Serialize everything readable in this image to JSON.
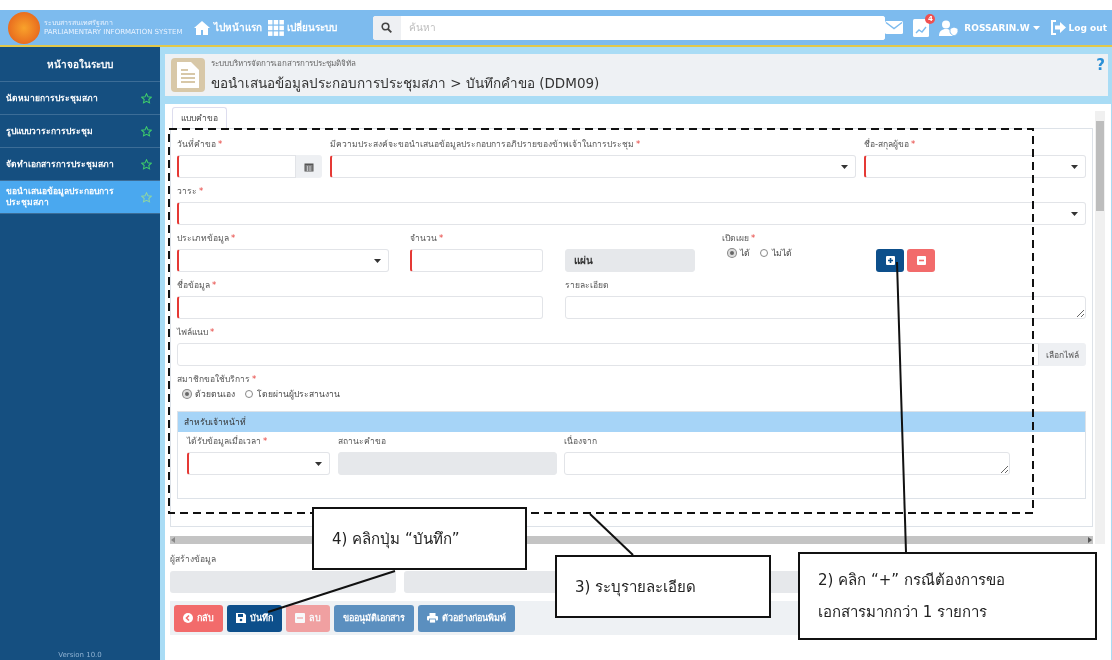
{
  "header": {
    "logo_title": "ระบบสารสนเทศรัฐสภา",
    "logo_subtitle": "PARLIAMENTARY INFORMATION SYSTEM",
    "nav": [
      {
        "label": "ไปหน้าแรก",
        "kind": "home"
      },
      {
        "label": "เปลี่ยนระบบ",
        "kind": "apps"
      }
    ],
    "search": {
      "placeholder": "ค้นหา"
    },
    "notification_badge": "4",
    "user": "ROSSARIN.W",
    "logout": "Log out"
  },
  "sidebar": {
    "title": "หน้าจอในระบบ",
    "items": [
      {
        "label": "นัดหมายการประชุมสภา",
        "selected": false
      },
      {
        "label": "รูปแบบวาระการประชุม",
        "selected": false
      },
      {
        "label": "จัดทำเอกสารการประชุมสภา",
        "selected": false
      },
      {
        "label": "ขอนำเสนอข้อมูลประกอบการประชุมสภา",
        "selected": true
      }
    ],
    "version": "Version 10.0"
  },
  "page": {
    "subtitle": "ระบบบริหารจัดการเอกสารการประชุมดิจิทัล",
    "title": "ขอนำเสนอข้อมูลประกอบการประชุมสภา > บันทึกคำขอ (DDM09)",
    "help": "?"
  },
  "tabs": [
    {
      "label": "แบบคำขอ",
      "selected": true
    }
  ],
  "form": {
    "rows": [
      {
        "fields": [
          {
            "kind": "date",
            "label": "วันที่คำขอ",
            "required_mark": "*",
            "invalid": true
          },
          {
            "kind": "select",
            "label": "มีความประสงค์จะขอนำเสนอข้อมูลประกอบการอภิปรายของข้าพเจ้าในการประชุม",
            "required_mark": "*",
            "invalid": true
          },
          {
            "kind": "select",
            "label": "ชื่อ-สกุลผู้ขอ",
            "required_mark": "*",
            "invalid": true
          }
        ]
      },
      {
        "fields": [
          {
            "kind": "select",
            "label": "วาระ",
            "required_mark": "*",
            "invalid": true
          }
        ]
      },
      {
        "fields": [
          {
            "kind": "select",
            "label": "ประเภทข้อมูล",
            "required_mark": "*",
            "invalid": true
          },
          {
            "kind": "text",
            "label": "จำนวน",
            "required_mark": "*",
            "invalid": true
          },
          {
            "kind": "readonly",
            "value": "แผ่น"
          },
          {
            "kind": "radio",
            "label": "เปิดเผย",
            "required_mark": "*",
            "options": [
              {
                "label": "ได้",
                "selected": true
              },
              {
                "label": "ไม่ได้",
                "selected": false
              }
            ]
          },
          {
            "kind": "add_remove"
          }
        ]
      },
      {
        "fields": [
          {
            "kind": "text",
            "label": "ชื่อข้อมูล",
            "required_mark": "*",
            "invalid": true
          },
          {
            "kind": "textarea",
            "label": "รายละเอียด",
            "invalid": false
          }
        ]
      },
      {
        "fields": [
          {
            "kind": "file",
            "label": "ไฟล์แนบ",
            "required_mark": "*",
            "button_label": "เลือกไฟล์",
            "invalid": false
          }
        ]
      },
      {
        "fields": [
          {
            "kind": "radio",
            "label": "สมาชิกขอใช้บริการ",
            "required_mark": "*",
            "options": [
              {
                "label": "ด้วยตนเอง",
                "selected": true
              },
              {
                "label": "โดยผ่านผู้ประสานงาน",
                "selected": false
              }
            ]
          }
        ]
      }
    ],
    "staff_section": {
      "title": "สำหรับเจ้าหน้าที่",
      "rows": [
        {
          "fields": [
            {
              "kind": "select",
              "label": "ได้รับข้อมูลเมื่อเวลา",
              "required_mark": "*",
              "invalid": true
            },
            {
              "kind": "readonly",
              "label": "สถานะคำขอ"
            },
            {
              "kind": "textarea",
              "label": "เนื่องจาก",
              "invalid": false
            }
          ]
        }
      ]
    }
  },
  "creator": {
    "label": "ผู้สร้างข้อมูล"
  },
  "actions": [
    {
      "label": "กลับ",
      "kind": "back",
      "disabled": false
    },
    {
      "label": "บันทึก",
      "kind": "save",
      "disabled": false
    },
    {
      "label": "ลบ",
      "kind": "delete",
      "disabled": true
    },
    {
      "label": "ขออนุมัติเอกสาร",
      "kind": "approve",
      "disabled": false
    },
    {
      "label": "ตัวอย่างก่อนพิมพ์",
      "kind": "print",
      "disabled": false
    }
  ],
  "callouts": [
    {
      "text": "4) คลิกปุ่ม “บันทึก”"
    },
    {
      "text": "3) ระบุรายละเอียด"
    },
    {
      "text": "2) คลิก “+” กรณีต้องการขอ เอกสารมากกว่า 1 รายการ"
    }
  ]
}
